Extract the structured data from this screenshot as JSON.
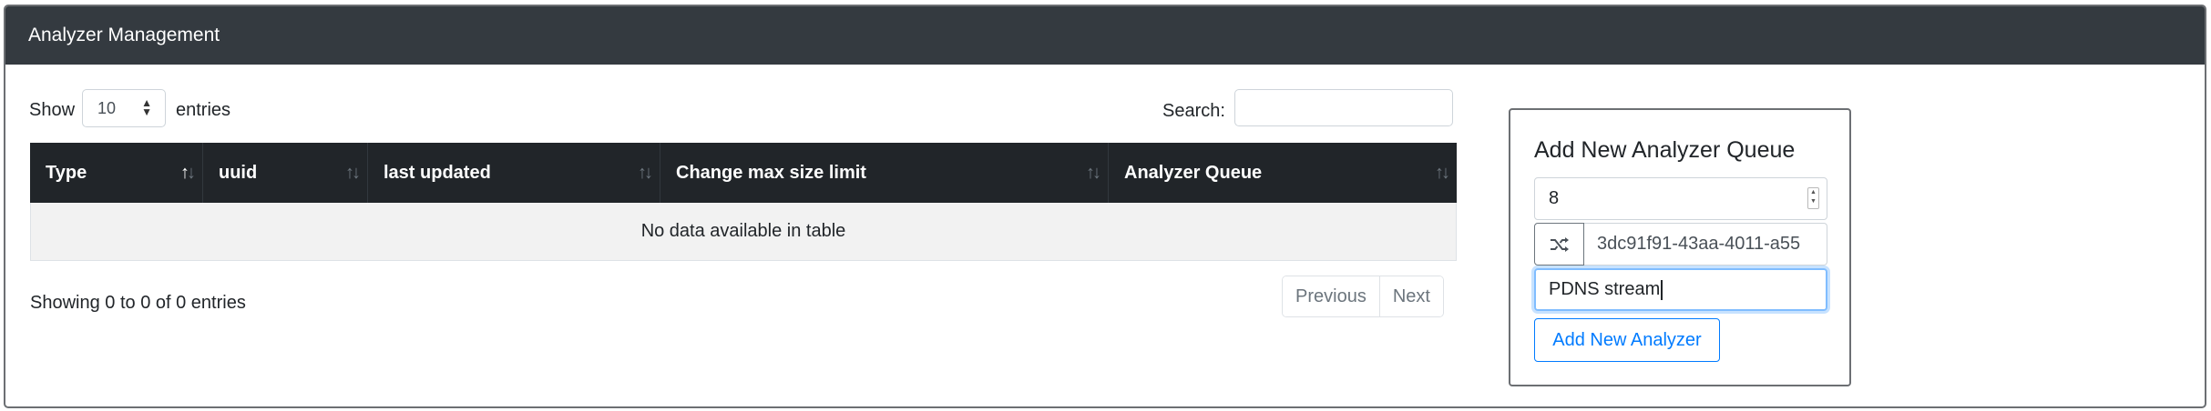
{
  "header": {
    "title": "Analyzer Management"
  },
  "length_menu": {
    "show_label": "Show",
    "value": "10",
    "entries_label": "entries"
  },
  "search": {
    "label": "Search:",
    "value": ""
  },
  "table": {
    "columns": [
      {
        "label": "Type",
        "sort_icon": "sort-asc-icon"
      },
      {
        "label": "uuid",
        "sort_icon": "sort-icon"
      },
      {
        "label": "last updated",
        "sort_icon": "sort-icon"
      },
      {
        "label": "Change max size limit",
        "sort_icon": "sort-icon"
      },
      {
        "label": "Analyzer Queue",
        "sort_icon": "sort-icon"
      }
    ],
    "empty_message": "No data available in table"
  },
  "info": {
    "text": "Showing 0 to 0 of 0 entries"
  },
  "pagination": {
    "previous": "Previous",
    "next": "Next"
  },
  "add_panel": {
    "title": "Add New Analyzer Queue",
    "queue_type_value": "8",
    "uuid_value": "3dc91f91-43aa-4011-a55",
    "shuffle_icon": "shuffle-icon",
    "description_value": "PDNS stream",
    "submit_label": "Add New Analyzer"
  },
  "colors": {
    "header_bg": "#343a40",
    "table_header_bg": "#212529",
    "primary": "#007bff"
  }
}
